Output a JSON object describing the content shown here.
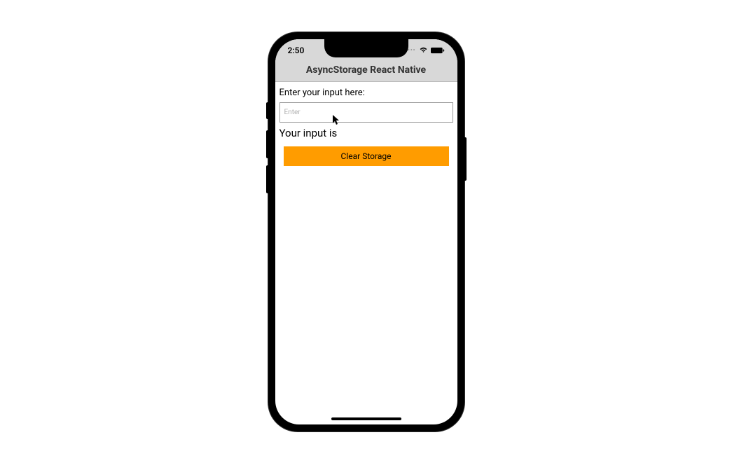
{
  "status_bar": {
    "time": "2:50"
  },
  "header": {
    "title": "AsyncStorage React Native"
  },
  "form": {
    "input_label": "Enter your input here:",
    "input_placeholder": "Enter",
    "input_value": "",
    "result_text": "Your input is",
    "clear_button_label": "Clear Storage"
  },
  "colors": {
    "button_bg": "#ff9c00",
    "header_bg": "#d8d8d8"
  }
}
